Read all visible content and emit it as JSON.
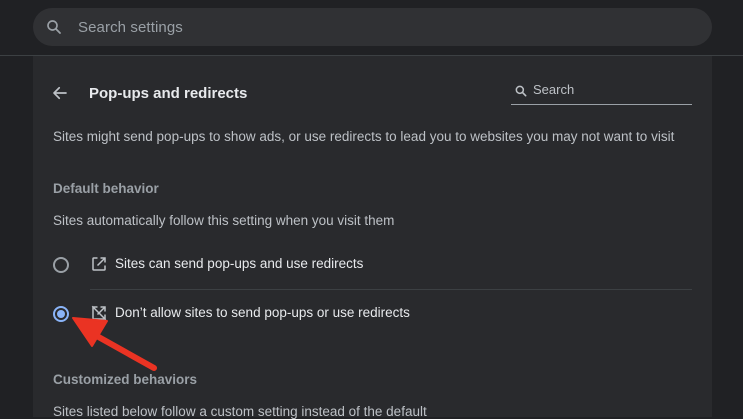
{
  "top_search": {
    "placeholder": "Search settings",
    "icon": "search-icon"
  },
  "header": {
    "title": "Pop-ups and redirects",
    "back_icon": "arrow-back-icon",
    "search_placeholder": "Search",
    "search_icon": "search-icon"
  },
  "description": "Sites might send pop-ups to show ads, or use redirects to lead you to websites you may not want to visit",
  "default_behavior": {
    "title": "Default behavior",
    "subtitle": "Sites automatically follow this setting when you visit them",
    "options": [
      {
        "label": "Sites can send pop-ups and use redirects",
        "icon": "open-in-new-icon",
        "selected": false
      },
      {
        "label": "Don’t allow sites to send pop-ups or use redirects",
        "icon": "popup-blocked-icon",
        "selected": true
      }
    ]
  },
  "customized_behaviors": {
    "title": "Customized behaviors",
    "subtitle": "Sites listed below follow a custom setting instead of the default"
  },
  "colors": {
    "background": "#202124",
    "card": "#292a2d",
    "accent": "#8ab4f8",
    "annotation_arrow": "#ea3323"
  }
}
